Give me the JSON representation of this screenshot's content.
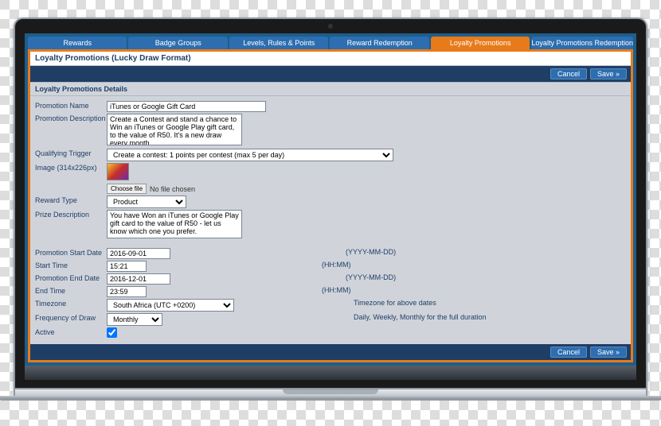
{
  "tabs": {
    "rewards": "Rewards",
    "badge_groups": "Badge Groups",
    "levels": "Levels, Rules & Points",
    "redemption": "Reward Redemption",
    "loyalty": "Loyalty Promotions",
    "loyalty_redemption": "Loyalty Promotions Redemption"
  },
  "page": {
    "title": "Loyalty Promotions (Lucky Draw Format)",
    "section": "Loyalty Promotions Details",
    "cancel": "Cancel",
    "save": "Save »"
  },
  "labels": {
    "name": "Promotion Name",
    "desc": "Promotion Description",
    "trigger": "Qualifying Trigger",
    "image": "Image (314x226px)",
    "choose_file": "Choose file",
    "no_file": "No file chosen",
    "reward_type": "Reward Type",
    "prize_desc": "Prize Description",
    "start_date": "Promotion Start Date",
    "start_time": "Start Time",
    "end_date": "Promotion End Date",
    "end_time": "End Time",
    "timezone": "Timezone",
    "freq": "Frequency of Draw",
    "active": "Active"
  },
  "values": {
    "name": "iTunes or Google Gift Card",
    "desc": "Create a Contest and stand a chance to Win an iTunes or Google Play gift card,  to the value of R50. It's a new draw every month.",
    "trigger": "Create a contest: 1 points per contest (max 5 per day)",
    "reward_type": "Product",
    "prize_desc": "You have Won an iTunes or Google Play gift card to the value of R50 - let us know which one you prefer.",
    "start_date": "2016-09-01",
    "start_time": "15:21",
    "end_date": "2016-12-01",
    "end_time": "23:59",
    "timezone": "South Africa (UTC +0200)",
    "freq": "Monthly"
  },
  "hints": {
    "date": "(YYYY-MM-DD)",
    "time": "(HH:MM)",
    "tz": "Timezone for above dates",
    "freq": "Daily, Weekly, Monthly for the full duration"
  }
}
